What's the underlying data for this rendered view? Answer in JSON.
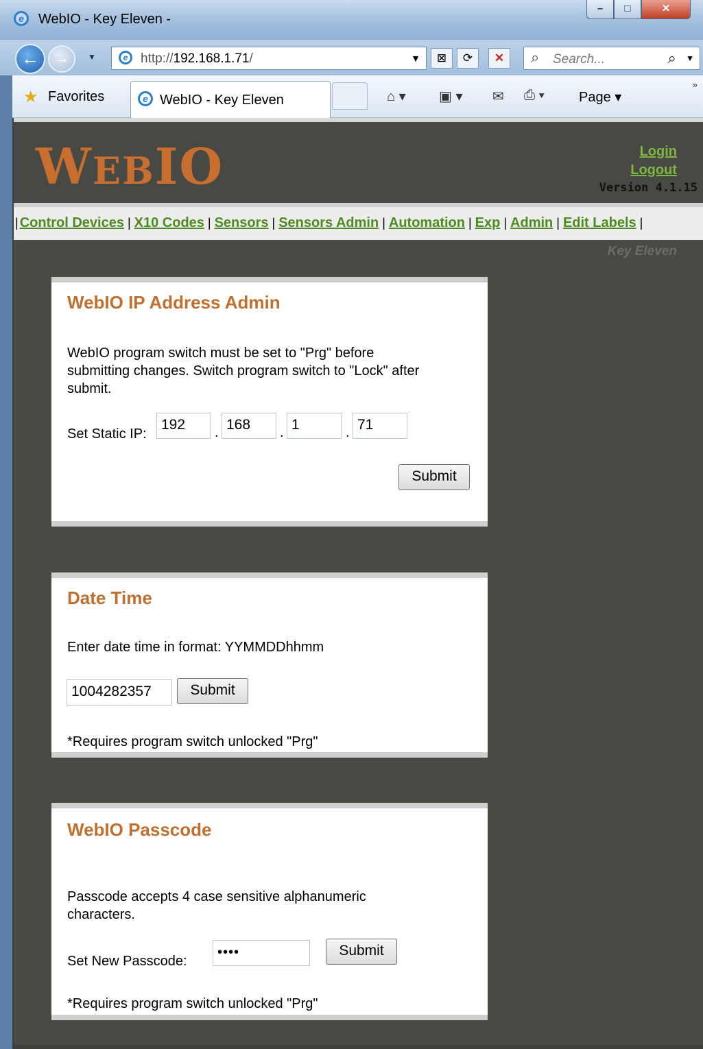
{
  "browser": {
    "window_title": "WebIO - Key Eleven -",
    "url_prefix": "http://",
    "url_host": "192.168.1.71",
    "url_suffix": "/",
    "search_placeholder": "Search...",
    "favorites_label": "Favorites",
    "tab_title": "WebIO - Key Eleven",
    "page_menu": "Page ▾",
    "window_controls": [
      "minimize",
      "maximize",
      "close"
    ]
  },
  "header": {
    "logo_big": "W",
    "logo_small": "EB",
    "logo_rest": "IO",
    "login": "Login",
    "logout": "Logout",
    "version": "Version 4.1.15",
    "subtitle": "Key Eleven"
  },
  "nav": {
    "items": [
      "Control Devices",
      "X10 Codes",
      "Sensors",
      "Sensors Admin",
      "Automation",
      "Exp",
      "Admin",
      "Edit Labels"
    ]
  },
  "ip_admin": {
    "title": "WebIO IP Address Admin",
    "desc_line1": "WebIO program switch must be set to \"Prg\" before",
    "desc_line2": "submitting changes. Switch program switch to \"Lock\" after",
    "desc_line3": "submit.",
    "label": "Set Static IP:",
    "octets": [
      "192",
      "168",
      "1",
      "71"
    ],
    "submit": "Submit"
  },
  "date_time": {
    "title": "Date Time",
    "desc": "Enter date time in format: YYMMDDhhmm",
    "value": "1004282357",
    "submit": "Submit",
    "note": "*Requires program switch unlocked \"Prg\""
  },
  "passcode": {
    "title": "WebIO Passcode",
    "desc_line1": "Passcode accepts 4 case sensitive alphanumeric",
    "desc_line2": "characters.",
    "label": "Set New Passcode:",
    "masked_value": "••••",
    "submit": "Submit",
    "note": "*Requires program switch unlocked \"Prg\""
  }
}
